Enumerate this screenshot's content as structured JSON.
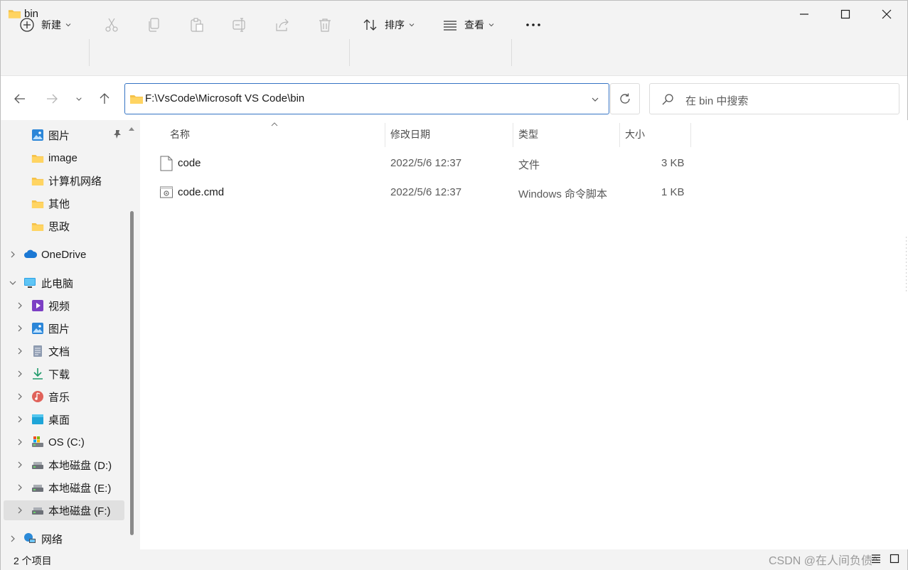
{
  "window": {
    "title": "bin"
  },
  "toolbar": {
    "new_label": "新建",
    "sort_label": "排序",
    "view_label": "查看"
  },
  "address": {
    "path": "F:\\VsCode\\Microsoft VS Code\\bin",
    "search_placeholder": "在 bin 中搜索"
  },
  "sidebar": {
    "quick_access": [
      {
        "label": "图片",
        "icon": "pictures-icon"
      },
      {
        "label": "image",
        "icon": "folder-icon"
      },
      {
        "label": "计算机网络",
        "icon": "folder-icon"
      },
      {
        "label": "其他",
        "icon": "folder-icon"
      },
      {
        "label": "思政",
        "icon": "folder-icon"
      }
    ],
    "onedrive": "OneDrive",
    "this_pc": "此电脑",
    "pc_items": [
      {
        "label": "视频",
        "icon": "videos-icon"
      },
      {
        "label": "图片",
        "icon": "pictures-icon"
      },
      {
        "label": "文档",
        "icon": "documents-icon"
      },
      {
        "label": "下载",
        "icon": "downloads-icon"
      },
      {
        "label": "音乐",
        "icon": "music-icon"
      },
      {
        "label": "桌面",
        "icon": "desktop-icon"
      },
      {
        "label": "OS (C:)",
        "icon": "system-drive-icon"
      },
      {
        "label": "本地磁盘 (D:)",
        "icon": "drive-icon"
      },
      {
        "label": "本地磁盘 (E:)",
        "icon": "drive-icon"
      },
      {
        "label": "本地磁盘 (F:)",
        "icon": "drive-icon",
        "selected": true
      }
    ],
    "network": "网络"
  },
  "columns": {
    "name": "名称",
    "modified": "修改日期",
    "type": "类型",
    "size": "大小"
  },
  "files": [
    {
      "name": "code",
      "modified": "2022/5/6 12:37",
      "type": "文件",
      "size": "3 KB",
      "icon": "file-icon"
    },
    {
      "name": "code.cmd",
      "modified": "2022/5/6 12:37",
      "type": "Windows 命令脚本",
      "size": "1 KB",
      "icon": "cmd-script-icon"
    }
  ],
  "status": {
    "item_count": "2 个项目",
    "watermark": "CSDN @在人间负债^"
  },
  "colors": {
    "accent": "#3574c4",
    "folder": "#f5c249",
    "chrome": "#f3f3f3"
  }
}
